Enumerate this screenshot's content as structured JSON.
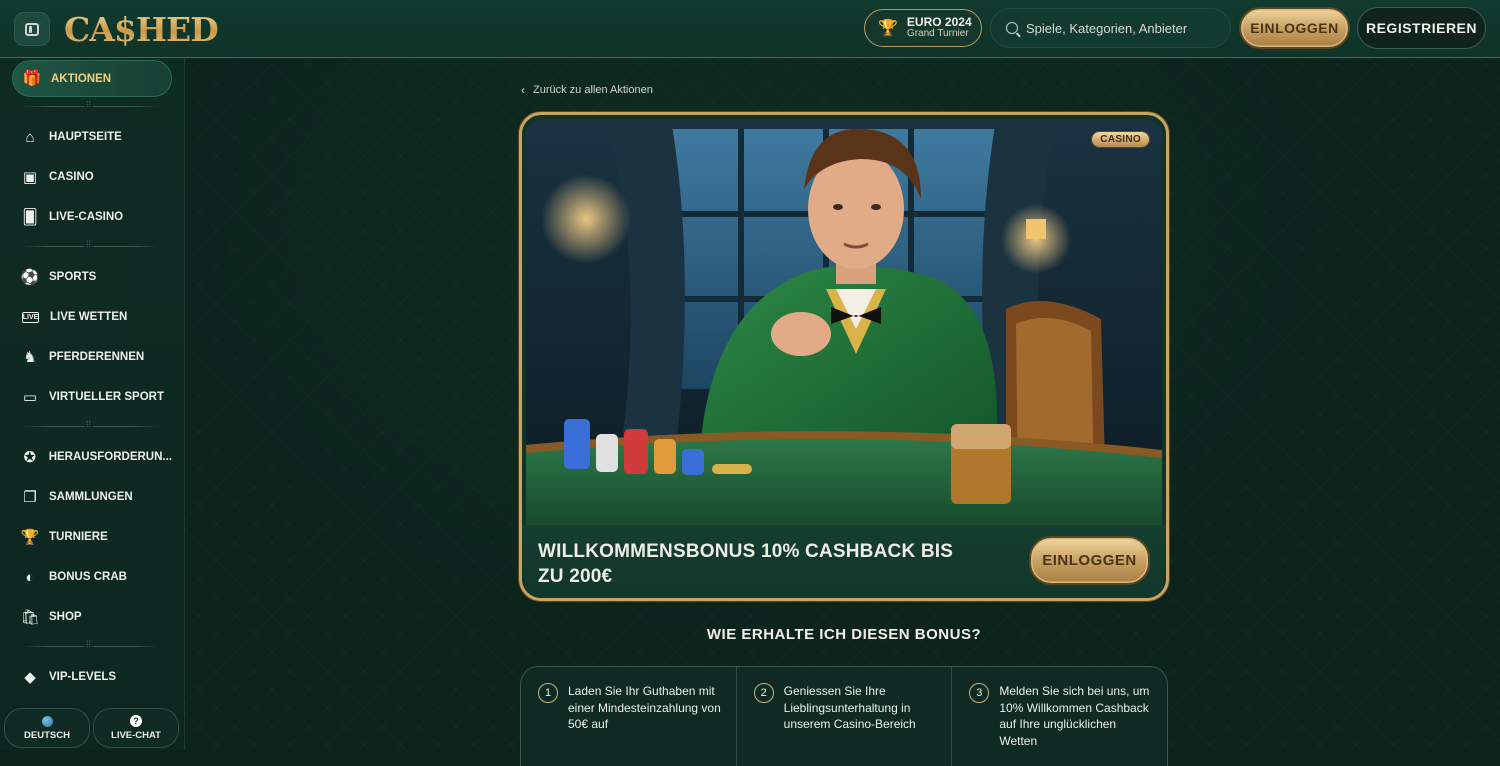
{
  "header": {
    "logo_text": "CA$HED",
    "euro_title": "EURO 2024",
    "euro_subtitle": "Grand Turnier",
    "search_placeholder": "Spiele, Kategorien, Anbieter",
    "login_label": "EINLOGGEN",
    "register_label": "REGISTRIEREN"
  },
  "sidebar": {
    "active": {
      "label": "AKTIONEN",
      "icon": "gift-icon"
    },
    "items": [
      {
        "label": "HAUPTSEITE",
        "icon": "home-icon"
      },
      {
        "label": "CASINO",
        "icon": "slot-machine-icon"
      },
      {
        "label": "LIVE-CASINO",
        "icon": "cards-icon"
      },
      {
        "label": "SPORTS",
        "icon": "soccer-ball-icon"
      },
      {
        "label": "LIVE WETTEN",
        "icon": "live-icon"
      },
      {
        "label": "PFERDERENNEN",
        "icon": "horse-icon"
      },
      {
        "label": "VIRTUELLER SPORT",
        "icon": "virtual-screen-icon"
      },
      {
        "label": "HERAUSFORDERUN...",
        "icon": "challenge-icon"
      },
      {
        "label": "SAMMLUNGEN",
        "icon": "collection-icon"
      },
      {
        "label": "TURNIERE",
        "icon": "trophy-icon"
      },
      {
        "label": "BONUS CRAB",
        "icon": "crab-icon"
      },
      {
        "label": "SHOP",
        "icon": "shopping-bag-icon"
      },
      {
        "label": "VIP-LEVELS",
        "icon": "diamond-icon"
      }
    ],
    "language_label": "DEUTSCH",
    "livechat_label": "LIVE-CHAT"
  },
  "main": {
    "back_link": "Zurück zu allen Aktionen",
    "promo": {
      "badge": "CASINO",
      "title": "WILLKOMMENSBONUS 10% CASHBACK BIS ZU 200€",
      "login_label": "EINLOGGEN"
    },
    "how_title": "WIE ERHALTE ICH DIESEN BONUS?",
    "steps": [
      {
        "num": "1",
        "text": "Laden Sie Ihr Guthaben mit einer Mindesteinzahlung von 50€ auf"
      },
      {
        "num": "2",
        "text": "Geniessen Sie Ihre Lieblingsunterhaltung in unserem Casino-Bereich"
      },
      {
        "num": "3",
        "text": "Melden Sie sich bei uns, um 10% Willkommen Cashback auf Ihre unglücklichen Wetten"
      }
    ]
  },
  "colors": {
    "background": "#0c231c",
    "gold_accent": "#c8a45e",
    "active_text": "#f3cf7d"
  }
}
